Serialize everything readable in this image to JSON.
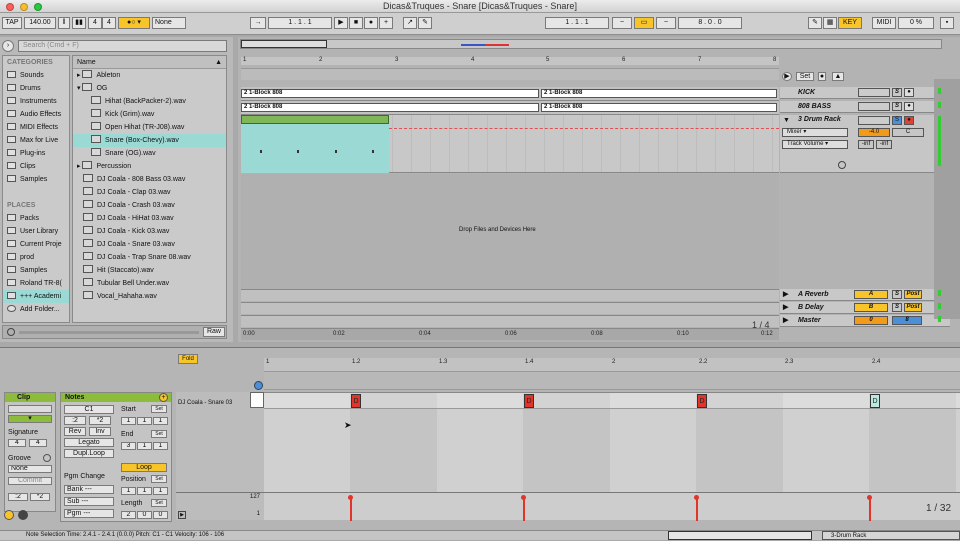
{
  "window": {
    "title": "Dicas&Truques - Snare  [Dicas&Truques - Snare]"
  },
  "control_bar": {
    "tap": "TAP",
    "tempo": "140.00",
    "sig_num": "4",
    "sig_den": "4",
    "quantize": "None",
    "position": "1 .  1 .  1",
    "loop_start": "1 .  1 .  1",
    "loop_length": "8 .  0 .  0",
    "key": "KEY",
    "midi": "MIDI",
    "cpu": "0 %"
  },
  "browser": {
    "search_placeholder": "Search (Cmd + F)",
    "categories_title": "CATEGORIES",
    "categories": [
      "Sounds",
      "Drums",
      "Instruments",
      "Audio Effects",
      "MIDI Effects",
      "Max for Live",
      "Plug-ins",
      "Clips",
      "Samples"
    ],
    "places_title": "PLACES",
    "places": [
      "Packs",
      "User Library",
      "Current Proje",
      "prod",
      "Samples",
      "Roland TR-8(",
      "+++ Academi",
      "Add Folder..."
    ],
    "name_header": "Name",
    "files": [
      "Ableton",
      "OG",
      "Hihat (BackPacker-2).wav",
      "Kick (Grim).wav",
      "Open Hihat (TR-J08).wav",
      "Snare (Box-Chevy).wav",
      "Snare (OG).wav",
      "Percussion",
      "DJ Coala - 808 Bass 03.wav",
      "DJ Coala - Clap 03.wav",
      "DJ Coala - Crash 03.wav",
      "DJ Coala - HiHat 03.wav",
      "DJ Coala - Kick 03.wav",
      "DJ Coala - Snare 03.wav",
      "DJ Coala - Trap Snare 08.wav",
      "Hit (Staccato).wav",
      "Tubular Bell Under.wav",
      "Vocal_Hahaha.wav"
    ],
    "raw": "Raw"
  },
  "arrangement": {
    "ruler": [
      "1",
      "2",
      "3",
      "4",
      "5",
      "6",
      "7",
      "8"
    ],
    "clips": [
      "2 1-Block 808",
      "2 1-Block 808",
      "2 1-Block 808",
      "2 1-Block 808"
    ],
    "drop_text": "Drop Files and Devices Here",
    "timeline": [
      "0:00",
      "0:02",
      "0:04",
      "0:06",
      "0:08",
      "0:10",
      "0:12"
    ],
    "zoom": "1 / 4",
    "set": "Set"
  },
  "tracks": {
    "kick": "KICK",
    "bass": "808 BASS",
    "drum": "3 Drum Rack",
    "mixer": "Mixer",
    "track_volume": "Track Volume",
    "vol": "-4.0",
    "pan": "C",
    "inf1": "-inf",
    "inf2": "-inf",
    "a_reverb": "A Reverb",
    "b_delay": "B Delay",
    "master": "Master",
    "a": "A",
    "b": "B",
    "s": "S",
    "post": "Post",
    "n1": "1",
    "n2": "2",
    "n3": "3"
  },
  "clip_view": {
    "fold": "Fold",
    "clip_title": "Clip",
    "notes_title": "Notes",
    "signature_label": "Signature",
    "sig_a": "4",
    "sig_b": "4",
    "groove_label": "Groove",
    "groove": "None",
    "commit": "Commit",
    "note_c1": "C1",
    "rev": "Rev",
    "inv": "Inv",
    "legato": "Legato",
    "dupl_loop": "Dupl.Loop",
    "pgm_change": "Pgm Change",
    "bank": "Bank ---",
    "sub": "Sub ---",
    "pgm": "Pgm ---",
    "start": "Start",
    "end": "End",
    "loop": "Loop",
    "position": "Position",
    "length": "Length",
    "start_val": [
      "1",
      "1",
      "1"
    ],
    "end_val": [
      "3",
      "1",
      "1"
    ],
    "pos_val": [
      "1",
      "1",
      "1"
    ],
    "len_val": [
      "2",
      "0",
      "0"
    ],
    "set": "Set",
    "ruler": [
      "1",
      "1.2",
      "1.3",
      "1.4",
      "2",
      "2.2",
      "2.3",
      "2.4"
    ],
    "row_label": "DJ Coala - Snare 03",
    "note_letter": "D",
    "vel_max": "127",
    "vel_min": "1",
    "zoom": "1 / 32"
  },
  "status": {
    "text": "Note Selection   Time: 2.4.1 - 2.4.1 (0.0.0)     Pitch: C1 - C1     Velocity: 106 - 106",
    "device": "3-Drum Rack"
  },
  "colors": {
    "accent": "#f7c52a",
    "clip_teal": "#9bd9d4",
    "note": "#e3342a",
    "green": "#8dbb3c"
  }
}
